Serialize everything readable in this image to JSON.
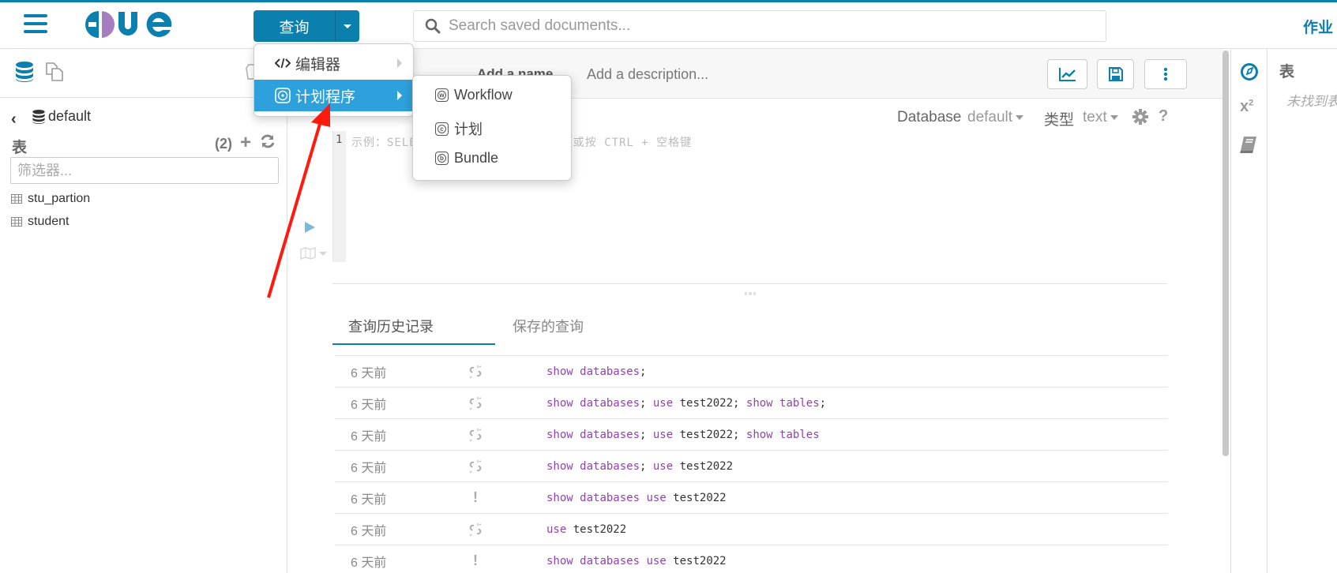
{
  "topbar": {
    "query_button_label": "查询",
    "search_placeholder": "Search saved documents...",
    "jobs_label": "作业"
  },
  "query_menu": {
    "items": [
      {
        "label": "编辑器",
        "icon": "code-icon",
        "active": false
      },
      {
        "label": "计划程序",
        "icon": "scheduler-icon",
        "active": true
      }
    ],
    "submenu": [
      {
        "label": "Workflow",
        "glyph": "w",
        "icon": "workflow-icon"
      },
      {
        "label": "计划",
        "glyph": "c",
        "icon": "schedule-icon"
      },
      {
        "label": "Bundle",
        "glyph": "b",
        "icon": "bundle-icon"
      }
    ]
  },
  "left_panel": {
    "database": "default",
    "tables_label": "表",
    "tables_count": "(2)",
    "filter_placeholder": "筛选器...",
    "tables": [
      "stu_partion",
      "student"
    ]
  },
  "editor": {
    "name_placeholder": "Add a name...",
    "description_placeholder": "Add a description...",
    "database_label": "Database",
    "database_value": "default",
    "type_label": "类型",
    "type_value": "text",
    "line_number": "1",
    "placeholder": "示例：SELECT * FROM tablename, 或按 CTRL + 空格键"
  },
  "history": {
    "tabs": [
      "查询历史记录",
      "保存的查询"
    ],
    "active_tab": 0,
    "rows": [
      {
        "time": "6 天前",
        "status": "unlinked",
        "tokens": [
          [
            "kw",
            "show"
          ],
          [
            "pl",
            " "
          ],
          [
            "kw",
            "databases"
          ],
          [
            "pl",
            ";"
          ]
        ]
      },
      {
        "time": "6 天前",
        "status": "unlinked",
        "tokens": [
          [
            "kw",
            "show"
          ],
          [
            "pl",
            " "
          ],
          [
            "kw",
            "databases"
          ],
          [
            "pl",
            "; "
          ],
          [
            "kw",
            "use"
          ],
          [
            "pl",
            " test2022; "
          ],
          [
            "kw",
            "show"
          ],
          [
            "pl",
            " "
          ],
          [
            "kw",
            "tables"
          ],
          [
            "pl",
            ";"
          ]
        ]
      },
      {
        "time": "6 天前",
        "status": "unlinked",
        "tokens": [
          [
            "kw",
            "show"
          ],
          [
            "pl",
            " "
          ],
          [
            "kw",
            "databases"
          ],
          [
            "pl",
            "; "
          ],
          [
            "kw",
            "use"
          ],
          [
            "pl",
            " test2022; "
          ],
          [
            "kw",
            "show"
          ],
          [
            "pl",
            " "
          ],
          [
            "kw",
            "tables"
          ]
        ]
      },
      {
        "time": "6 天前",
        "status": "unlinked",
        "tokens": [
          [
            "kw",
            "show"
          ],
          [
            "pl",
            " "
          ],
          [
            "kw",
            "databases"
          ],
          [
            "pl",
            "; "
          ],
          [
            "kw",
            "use"
          ],
          [
            "pl",
            " test2022"
          ]
        ]
      },
      {
        "time": "6 天前",
        "status": "error",
        "tokens": [
          [
            "kw",
            "show"
          ],
          [
            "pl",
            " "
          ],
          [
            "kw",
            "databases"
          ],
          [
            "pl",
            " "
          ],
          [
            "kw",
            "use"
          ],
          [
            "pl",
            " test2022"
          ]
        ]
      },
      {
        "time": "6 天前",
        "status": "unlinked",
        "tokens": [
          [
            "kw",
            "use"
          ],
          [
            "pl",
            " test2022"
          ]
        ]
      },
      {
        "time": "6 天前",
        "status": "error",
        "tokens": [
          [
            "kw",
            "show"
          ],
          [
            "pl",
            " "
          ],
          [
            "kw",
            "databases"
          ],
          [
            "pl",
            " "
          ],
          [
            "kw",
            "use"
          ],
          [
            "pl",
            " test2022"
          ]
        ]
      }
    ]
  },
  "right_panel": {
    "title": "表",
    "empty_text": "未找到表"
  },
  "colors": {
    "brand": "#0b7fad",
    "menu_active": "#2ea1dc",
    "keyword": "#8e44ad",
    "annotation_arrow": "#ff1a0d"
  }
}
